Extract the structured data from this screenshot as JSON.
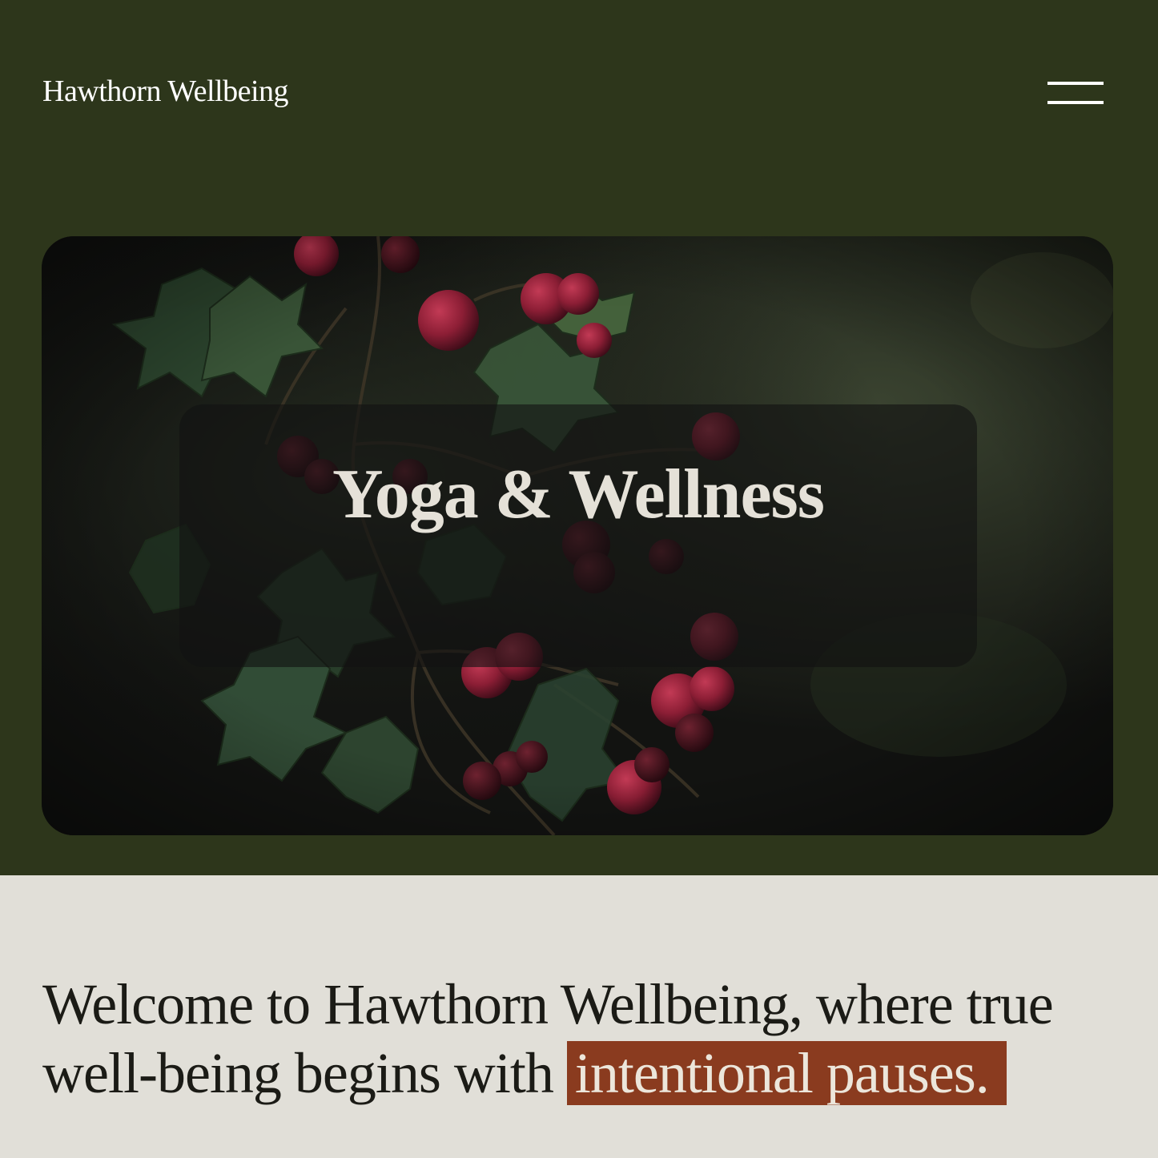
{
  "header": {
    "brand": "Hawthorn Wellbeing",
    "menu_icon": "hamburger-menu-icon"
  },
  "hero": {
    "title": "Yoga & Wellness",
    "image": "hawthorn-berries-photo"
  },
  "intro": {
    "text": "Welcome to Hawthorn Wellbeing, where true well-being begins with",
    "highlight": "intentional pauses."
  },
  "colors": {
    "background_green": "#2d361b",
    "intro_background": "#e1dfd8",
    "highlight": "#8a3b1f",
    "text_light": "#e5e1d8",
    "text_dark": "#1b1b16"
  }
}
